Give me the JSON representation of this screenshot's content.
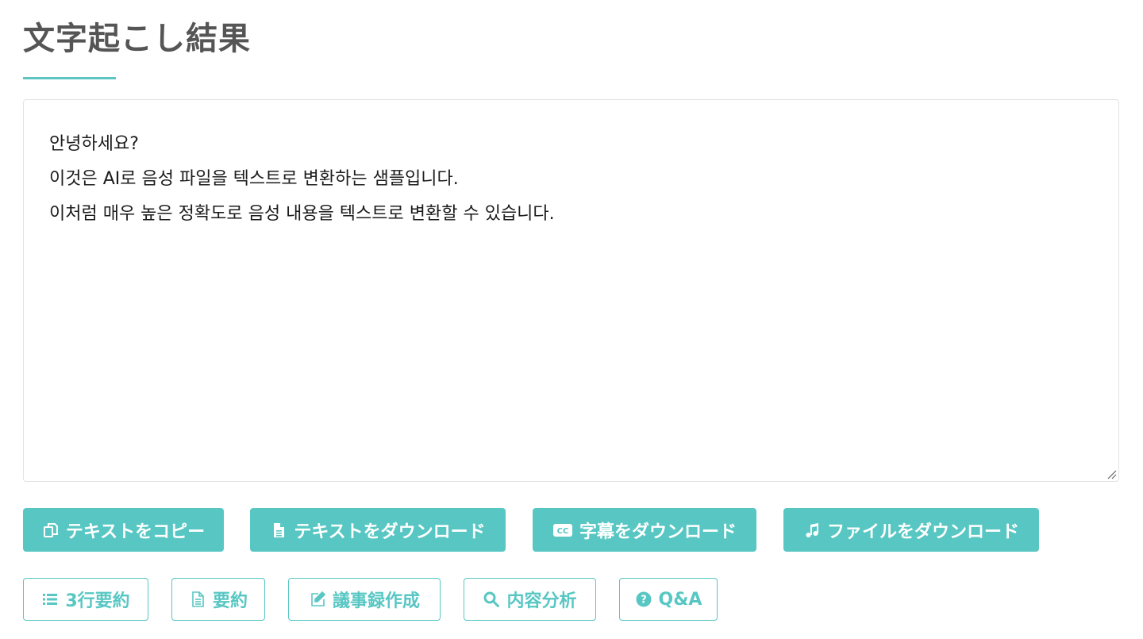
{
  "page": {
    "title": "文字起こし結果"
  },
  "transcript": {
    "lines": [
      "안녕하세요?",
      "이것은 AI로 음성 파일을 텍스트로 변환하는 샘플입니다.",
      "이처럼 매우 높은 정확도로 음성 내용을 텍스트로 변환할 수 있습니다."
    ]
  },
  "actions": {
    "copy_text": {
      "label": "テキストをコピー",
      "icon": "copy-icon"
    },
    "download_text": {
      "label": "テキストをダウンロード",
      "icon": "file-icon"
    },
    "download_subtitles": {
      "label": "字幕をダウンロード",
      "icon": "cc-icon"
    },
    "download_file": {
      "label": "ファイルをダウンロード",
      "icon": "music-icon"
    }
  },
  "analysis": {
    "three_line_summary": {
      "label": "3行要約",
      "icon": "list-icon"
    },
    "summary": {
      "label": "要約",
      "icon": "document-icon"
    },
    "minutes": {
      "label": "議事録作成",
      "icon": "edit-icon"
    },
    "content_analysis": {
      "label": "内容分析",
      "icon": "search-icon"
    },
    "qa": {
      "label": "Q&A",
      "icon": "question-icon"
    }
  },
  "colors": {
    "accent": "#58c7c3",
    "title": "#555555",
    "text": "#1c1c1c"
  }
}
